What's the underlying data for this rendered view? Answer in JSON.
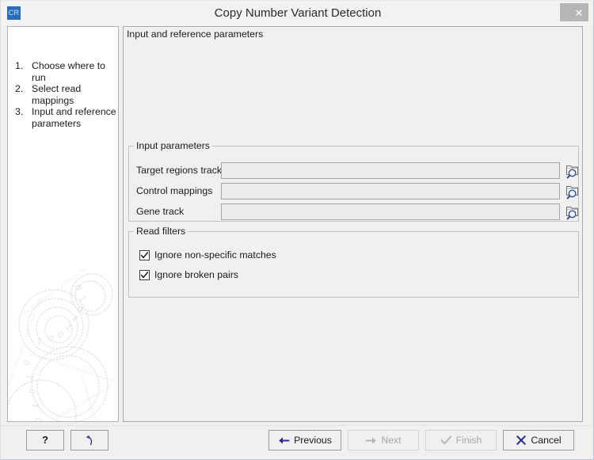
{
  "window": {
    "title": "Copy Number Variant Detection",
    "app_icon_text": "CR",
    "close_label": "✕"
  },
  "sidebar": {
    "steps": [
      {
        "number": "1.",
        "label": "Choose where to run"
      },
      {
        "number": "2.",
        "label": "Select read mappings"
      },
      {
        "number": "3.",
        "label": "Input and reference parameters"
      }
    ]
  },
  "content": {
    "header": "Input and reference parameters",
    "input_parameters": {
      "title": "Input parameters",
      "fields": [
        {
          "label": "Target regions track",
          "value": "",
          "placeholder": "",
          "browse_icon": "folder-search-icon"
        },
        {
          "label": "Control mappings",
          "value": "",
          "placeholder": "",
          "browse_icon": "folder-search-icon"
        },
        {
          "label": "Gene track",
          "value": "",
          "placeholder": "",
          "browse_icon": "folder-search-icon"
        }
      ]
    },
    "read_filters": {
      "title": "Read filters",
      "options": [
        {
          "label": "Ignore non-specific matches",
          "checked": true
        },
        {
          "label": "Ignore broken pairs",
          "checked": true
        }
      ]
    }
  },
  "buttons": {
    "help": {
      "label": "?",
      "icon": "question-mark-icon",
      "enabled": true
    },
    "reset": {
      "label": "",
      "icon": "undo-arrow-icon",
      "enabled": true
    },
    "previous": {
      "label": "Previous",
      "icon": "arrow-left-icon",
      "enabled": true
    },
    "next": {
      "label": "Next",
      "icon": "arrow-right-icon",
      "enabled": false
    },
    "finish": {
      "label": "Finish",
      "icon": "checkmark-icon",
      "enabled": false
    },
    "cancel": {
      "label": "Cancel",
      "icon": "cross-icon",
      "enabled": true
    }
  },
  "colors": {
    "accent_blue": "#2a2a8c",
    "app_icon_bg": "#2a6ebb",
    "window_bg": "#f0f0f0",
    "panel_bg": "#ffffff",
    "disabled_text": "#a6a6a6"
  }
}
